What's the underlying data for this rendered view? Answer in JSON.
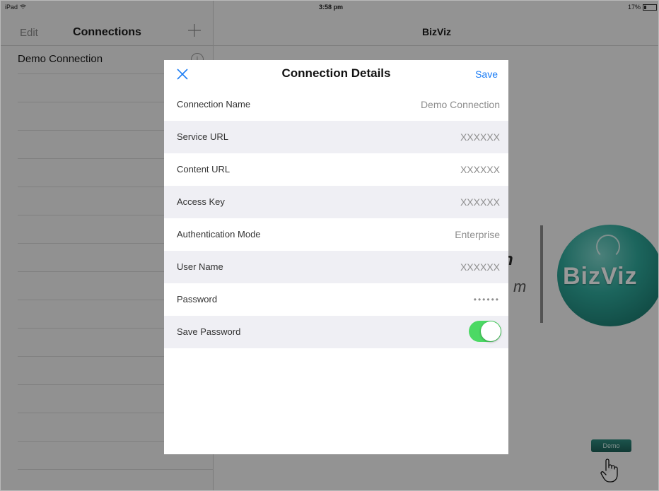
{
  "status_bar": {
    "carrier": "iPad",
    "wifi_icon": "wifi-icon",
    "time": "3:58 pm",
    "battery_text": "17%",
    "battery_level": 0.17
  },
  "master": {
    "edit_label": "Edit",
    "title": "Connections",
    "add_icon": "plus-icon",
    "connections": [
      {
        "label": "Demo Connection",
        "info_icon": "info-icon"
      }
    ]
  },
  "detail": {
    "title": "BizViz",
    "background": {
      "partial_letter_bold": "n",
      "partial_letter_italic": "m",
      "logo_text": "BizViz",
      "demo_button_label": "Demo",
      "hand_icon": "pointer-hand-icon"
    }
  },
  "modal": {
    "close_icon": "close-icon",
    "title": "Connection Details",
    "save_label": "Save",
    "fields": [
      {
        "label": "Connection Name",
        "value": "Demo Connection"
      },
      {
        "label": "Service URL",
        "value": "XXXXXX"
      },
      {
        "label": "Content URL",
        "value": "XXXXXX"
      },
      {
        "label": "Access Key",
        "value": "XXXXXX"
      },
      {
        "label": "Authentication Mode",
        "value": "Enterprise"
      },
      {
        "label": "User Name",
        "value": "XXXXXX"
      },
      {
        "label": "Password",
        "value": "••••••"
      }
    ],
    "save_password": {
      "label": "Save Password",
      "enabled": true
    }
  },
  "colors": {
    "accent_blue": "#1a7cf5",
    "toggle_green": "#4cd964",
    "logo_teal": "#2fa99b"
  }
}
